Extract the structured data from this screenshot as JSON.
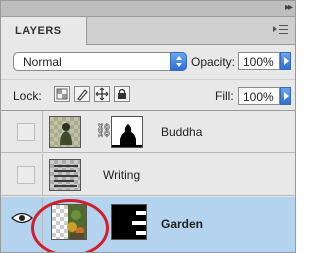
{
  "panel": {
    "tab_label": "LAYERS",
    "panel_menu_icon": "panel-menu-icon",
    "collapse_icon": "collapse-arrows-icon"
  },
  "blend": {
    "mode": "Normal",
    "opacity_label": "Opacity:",
    "opacity_value": "100%"
  },
  "lock": {
    "label": "Lock:",
    "buttons": [
      "lock-transparent-pixels-icon",
      "lock-image-pixels-icon",
      "lock-position-icon",
      "lock-all-icon"
    ],
    "fill_label": "Fill:",
    "fill_value": "100%"
  },
  "layers": [
    {
      "name": "Buddha",
      "visible": false,
      "selected": false,
      "has_mask": true,
      "linked": true
    },
    {
      "name": "Writing",
      "visible": false,
      "selected": false,
      "has_mask": false,
      "linked": false
    },
    {
      "name": "Garden",
      "visible": true,
      "selected": true,
      "has_mask": true,
      "linked": false
    }
  ],
  "colors": {
    "selected_row": "#b3d3ef",
    "accent_blue": "#2c6ed6",
    "highlight_circle": "#d21f2b"
  }
}
